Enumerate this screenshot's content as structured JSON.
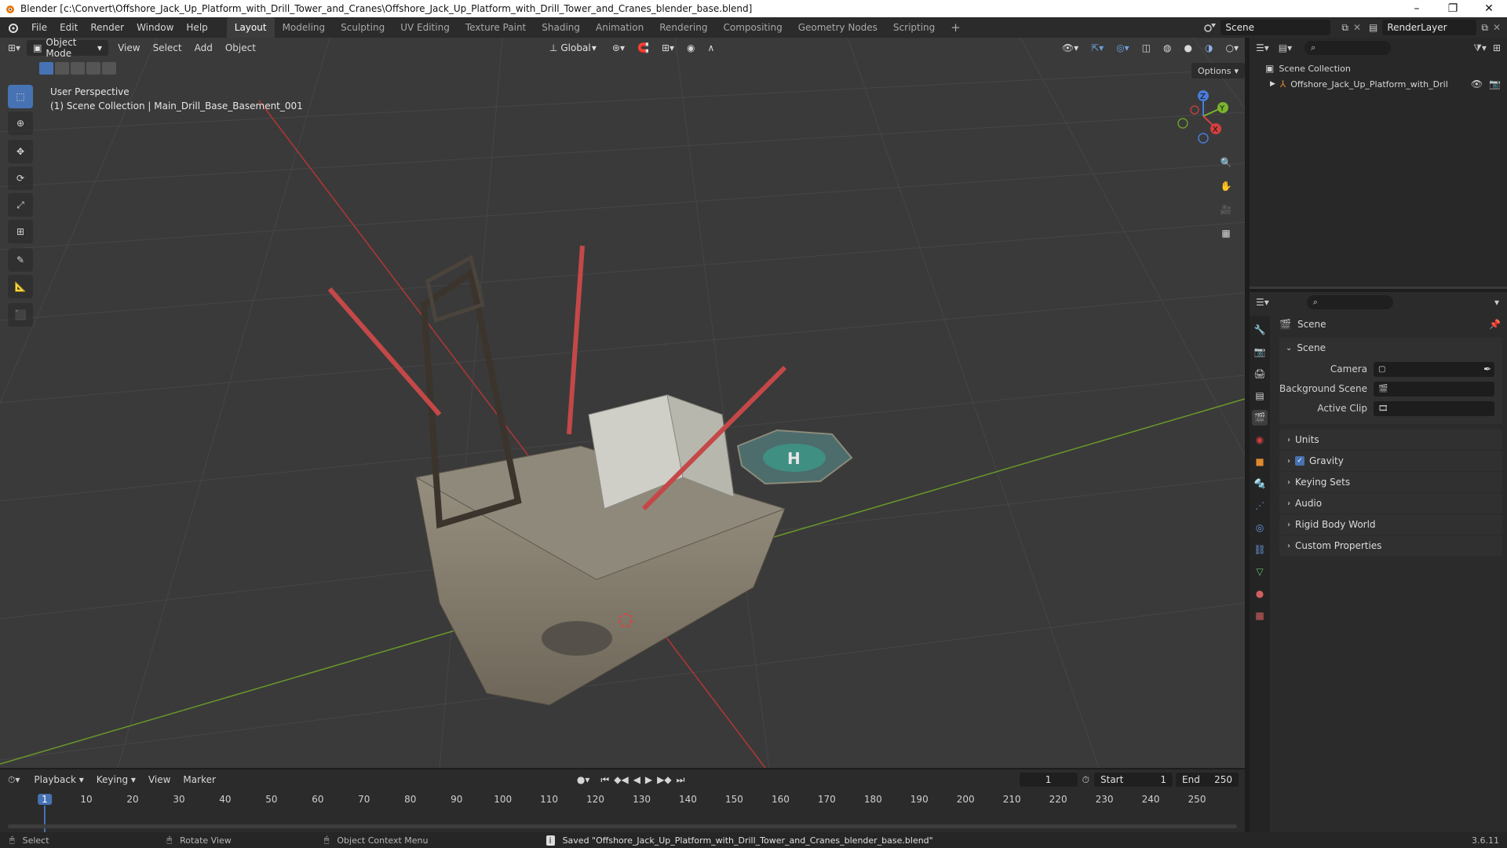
{
  "window": {
    "title": "Blender [c:\\Convert\\Offshore_Jack_Up_Platform_with_Drill_Tower_and_Cranes\\Offshore_Jack_Up_Platform_with_Drill_Tower_and_Cranes_blender_base.blend]",
    "minimize": "–",
    "maximize": "❐",
    "close": "✕"
  },
  "menu": {
    "items": [
      "File",
      "Edit",
      "Render",
      "Window",
      "Help"
    ]
  },
  "workspaces": {
    "tabs": [
      "Layout",
      "Modeling",
      "Sculpting",
      "UV Editing",
      "Texture Paint",
      "Shading",
      "Animation",
      "Rendering",
      "Compositing",
      "Geometry Nodes",
      "Scripting"
    ],
    "active": "Layout",
    "add": "+"
  },
  "scene_selector": {
    "label": "Scene"
  },
  "render_layer": {
    "label": "RenderLayer"
  },
  "viewport": {
    "mode": "Object Mode",
    "menus": [
      "View",
      "Select",
      "Add",
      "Object"
    ],
    "orientation": "Global",
    "options": "Options",
    "overlay_line1": "User Perspective",
    "overlay_line2": "(1) Scene Collection | Main_Drill_Base_Basement_001",
    "gizmo": {
      "z": "Z",
      "y": "Y",
      "x": "X"
    },
    "helipad_letter": "H",
    "colors": {
      "x_axis": "#c03a3a",
      "y_axis": "#6a9a2a",
      "grid": "#454545",
      "bg": "#3a3a3a"
    }
  },
  "outliner": {
    "root": "Scene Collection",
    "item": "Offshore_Jack_Up_Platform_with_Drill_T"
  },
  "properties": {
    "header": "Scene",
    "section": "Scene",
    "fields": [
      {
        "label": "Camera",
        "value": ""
      },
      {
        "label": "Background Scene",
        "value": ""
      },
      {
        "label": "Active Clip",
        "value": ""
      }
    ],
    "panels": [
      "Units",
      "Gravity",
      "Keying Sets",
      "Audio",
      "Rigid Body World",
      "Custom Properties"
    ],
    "gravity_checked": true
  },
  "timeline": {
    "menus": [
      "Playback",
      "Keying",
      "View",
      "Marker"
    ],
    "current_frame": "1",
    "start_label": "Start",
    "start": "1",
    "end_label": "End",
    "end": "250",
    "ticks": [
      "1",
      "10",
      "20",
      "30",
      "40",
      "50",
      "60",
      "70",
      "80",
      "90",
      "100",
      "110",
      "120",
      "130",
      "140",
      "150",
      "160",
      "170",
      "180",
      "190",
      "200",
      "210",
      "220",
      "230",
      "240",
      "250"
    ]
  },
  "status": {
    "select": "Select",
    "rotate": "Rotate View",
    "context": "Object Context Menu",
    "message": "Saved \"Offshore_Jack_Up_Platform_with_Drill_Tower_and_Cranes_blender_base.blend\"",
    "version": "3.6.11"
  }
}
